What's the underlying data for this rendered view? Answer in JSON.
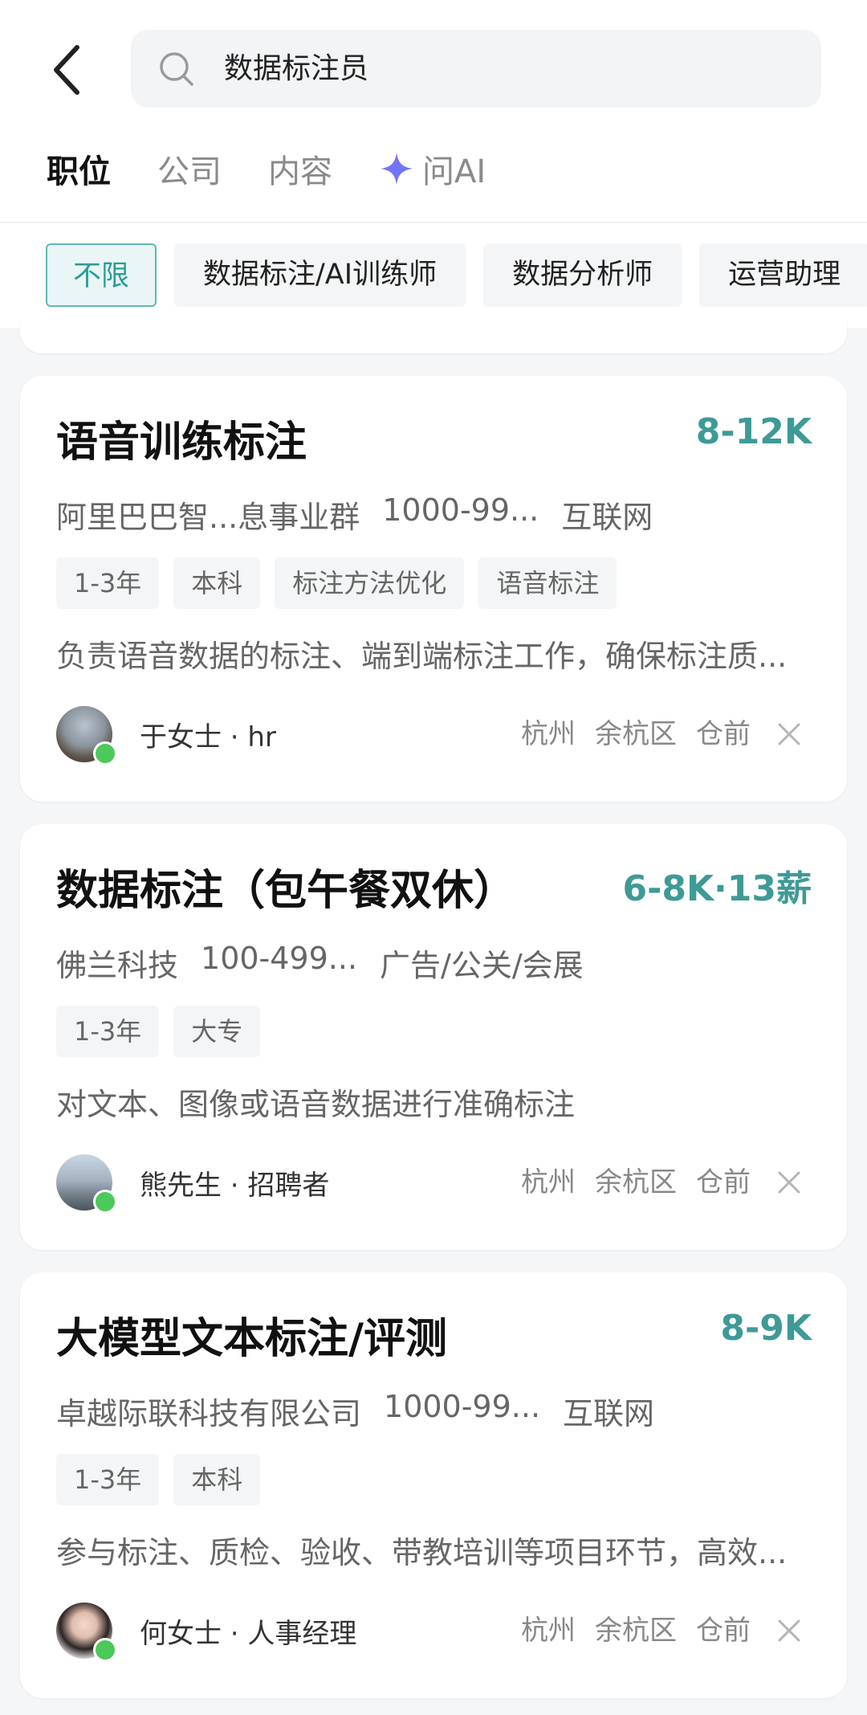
{
  "search": {
    "query": "数据标注员"
  },
  "tabs": [
    {
      "label": "职位"
    },
    {
      "label": "公司"
    },
    {
      "label": "内容"
    },
    {
      "label": "问AI"
    }
  ],
  "filters": [
    {
      "label": "不限"
    },
    {
      "label": "数据标注/AI训练师"
    },
    {
      "label": "数据分析师"
    },
    {
      "label": "运营助理"
    }
  ],
  "jobs": [
    {
      "title": "语音训练标注",
      "salary": "8-12K",
      "company": "阿里巴巴智...息事业群",
      "size": "1000-99...",
      "industry": "互联网",
      "tags": [
        "1-3年",
        "本科",
        "标注方法优化",
        "语音标注"
      ],
      "description": "负责语音数据的标注、端到端标注工作，确保标注质...",
      "recruiter": "于女士 · hr",
      "city": "杭州",
      "district": "余杭区",
      "area": "仓前",
      "accent": "#3e9a96"
    },
    {
      "title": "数据标注（包午餐双休）",
      "salary": "6-8K·13薪",
      "company": "佛兰科技",
      "size": "100-499...",
      "industry": "广告/公关/会展",
      "tags": [
        "1-3年",
        "大专"
      ],
      "description": "对文本、图像或语音数据进行准确标注",
      "recruiter": "熊先生 · 招聘者",
      "city": "杭州",
      "district": "余杭区",
      "area": "仓前"
    },
    {
      "title": "大模型文本标注/评测",
      "salary": "8-9K",
      "company": "卓越际联科技有限公司",
      "size": "1000-99...",
      "industry": "互联网",
      "tags": [
        "1-3年",
        "本科"
      ],
      "description": "参与标注、质检、验收、带教培训等项目环节，高效...",
      "recruiter": "何女士 · 人事经理",
      "city": "杭州",
      "district": "余杭区",
      "area": "仓前"
    }
  ]
}
